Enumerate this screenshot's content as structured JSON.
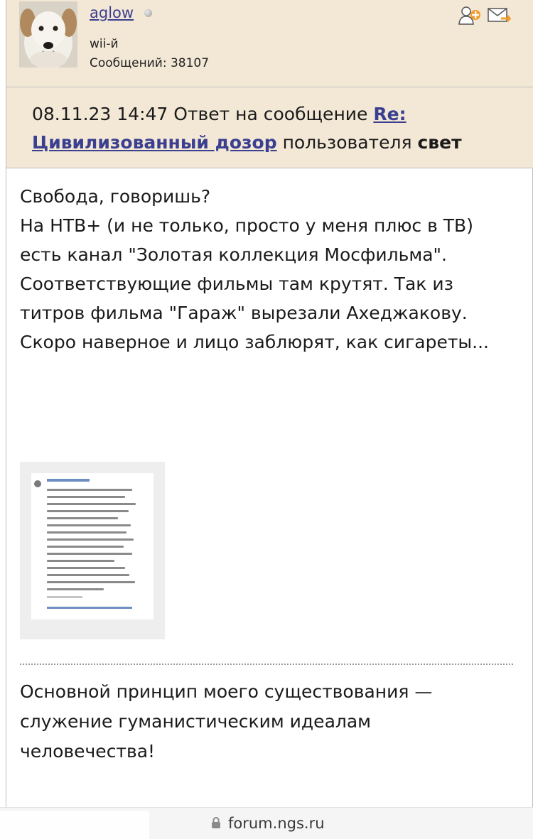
{
  "user": {
    "name": "aglow",
    "title": "wii-й",
    "posts_label": "Сообщений:",
    "posts_count": "38107"
  },
  "reply_header": {
    "datetime": "08.11.23 14:47",
    "text_prefix": "Ответ на сообщение",
    "topic_link": "Re: Цивилизованный дозор",
    "text_middle": "пользователя",
    "author": "свет"
  },
  "post": {
    "lines": [
      "Свобода, говоришь?",
      "На НТВ+ (и не только, просто у меня плюс в ТВ) есть канал \"Золотая коллекция Мосфильма\".",
      "Соответствующие фильмы там крутят. Так из титров фильма \"Гараж\" вырезали Ахеджакову. Скоро наверное и лицо заблюрят, как сигареты..."
    ]
  },
  "signature": "Основной принцип моего существования — служение гуманистическим идеалам человечества!",
  "browser": {
    "url": "forum.ngs.ru"
  },
  "colors": {
    "header_bg": "#f3e8d6",
    "link": "#3a3f8f"
  },
  "icons": {
    "add_friend": "add-friend-icon",
    "mail": "send-mail-icon",
    "status": "offline-status-icon",
    "lock": "lock-icon"
  }
}
